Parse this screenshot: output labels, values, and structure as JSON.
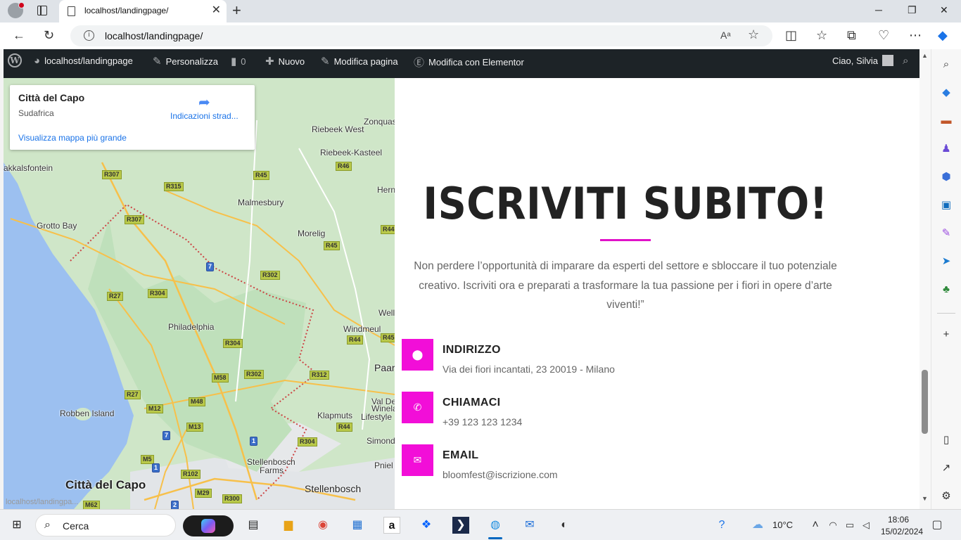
{
  "browser": {
    "tab_title": "localhost/landingpage/",
    "url": "localhost/landingpage/",
    "tab_close": "✕",
    "new_tab": "+"
  },
  "wp_admin": {
    "site": "localhost/landingpage",
    "customize": "Personalizza",
    "comments_count": "0",
    "new": "Nuovo",
    "edit_page": "Modifica pagina",
    "edit_elementor": "Modifica con Elementor",
    "greeting": "Ciao, Silvia"
  },
  "map": {
    "card": {
      "city": "Città del Capo",
      "country": "Sudafrica",
      "directions": "Indicazioni strad...",
      "view_larger": "Visualizza mappa più grande"
    },
    "labels": [
      "Zonquas",
      "Riebeek West",
      "Riebeek-Kasteel",
      "akkalsfontein",
      "Malmesbury",
      "Hern",
      "Grotto Bay",
      "Morelig",
      "Philadelphia",
      "Well",
      "Windmeul",
      "Paar",
      "Robben Island",
      "Klapmuts",
      "Val De",
      "Winela",
      "Lifestyle",
      "Simond",
      "Pniel",
      "Stellenbosch",
      "Farms",
      "Stellenbosch",
      "Città del Capo"
    ],
    "shields": [
      "R307",
      "R45",
      "R315",
      "R46",
      "R307",
      "R44",
      "R45",
      "7",
      "R302",
      "R27",
      "R304",
      "R304",
      "R44",
      "R45",
      "R312",
      "M58",
      "R302",
      "R27",
      "M48",
      "M12",
      "M13",
      "7",
      "1",
      "R44",
      "R304",
      "M5",
      "1",
      "R102",
      "M29",
      "R300",
      "M62",
      "2"
    ],
    "status_url": "localhost/landingpa..."
  },
  "signup": {
    "headline": "ISCRIVITI SUBITO!",
    "lead": "Non perdere l’opportunità di imparare da esperti del settore e sbloccare il tuo potenziale creativo. Iscriviti ora e preparati a trasformare la tua passione per i fiori in opere d’arte viventi!”",
    "accent_color": "#f20ed8",
    "contacts": [
      {
        "label": "INDIRIZZO",
        "value": "Via dei fiori incantati, 23 20019 - Milano",
        "icon": "map-pin-icon"
      },
      {
        "label": "CHIAMACI",
        "value": "+39 123 123 1234",
        "icon": "phone-icon"
      },
      {
        "label": "EMAIL",
        "value": "bloomfest@iscrizione.com",
        "icon": "envelope-icon"
      }
    ]
  },
  "taskbar": {
    "search": "Cerca",
    "weather": "10°C",
    "time": "18:06",
    "date": "15/02/2024",
    "store_icon_label": "a"
  }
}
